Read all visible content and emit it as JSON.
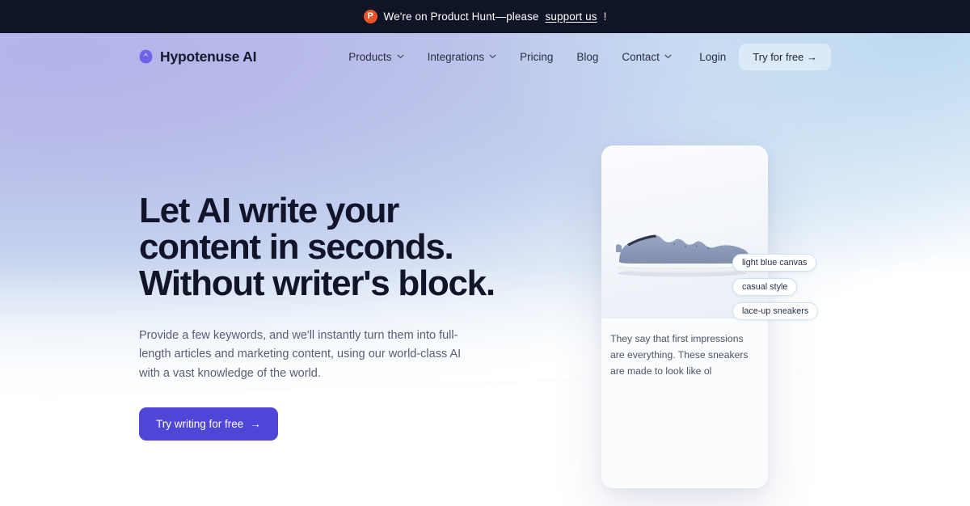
{
  "announcement": {
    "icon": "product-hunt-icon",
    "badge_letter": "P",
    "text_before": "We're on Product Hunt—please",
    "link_label": "support us",
    "text_after": "!"
  },
  "nav": {
    "brand": {
      "name": "Hypotenuse AI",
      "logo_icon": "hypotenuse-logo-icon",
      "logo_color": "#6f63e8"
    },
    "links": [
      {
        "label": "Products",
        "has_dropdown": true
      },
      {
        "label": "Integrations",
        "has_dropdown": true
      },
      {
        "label": "Pricing",
        "has_dropdown": false
      },
      {
        "label": "Blog",
        "has_dropdown": false
      },
      {
        "label": "Contact",
        "has_dropdown": true
      }
    ],
    "login_label": "Login",
    "try_label": "Try for free  →"
  },
  "hero": {
    "headline": "Let AI write your content in seconds. Without writer's block.",
    "subcopy": "Provide a few keywords, and we'll instantly turn them into full-length articles and marketing content, using our world-class AI with a vast knowledge of the world.",
    "cta_label": "Try writing for free",
    "cta_arrow": "→",
    "cta_color": "#4f46d8"
  },
  "product_card": {
    "image_alt": "light blue canvas lace-up sneaker",
    "tags": [
      "light blue canvas",
      "casual style",
      "lace-up sneakers"
    ],
    "generated_text": "They say that first impressions are everything. These sneakers are made to look like ol"
  },
  "background": {
    "purple": "#b4b4e8",
    "blue": "#c3dcf0",
    "white": "#ffffff",
    "announcement_bar": "#101427"
  }
}
